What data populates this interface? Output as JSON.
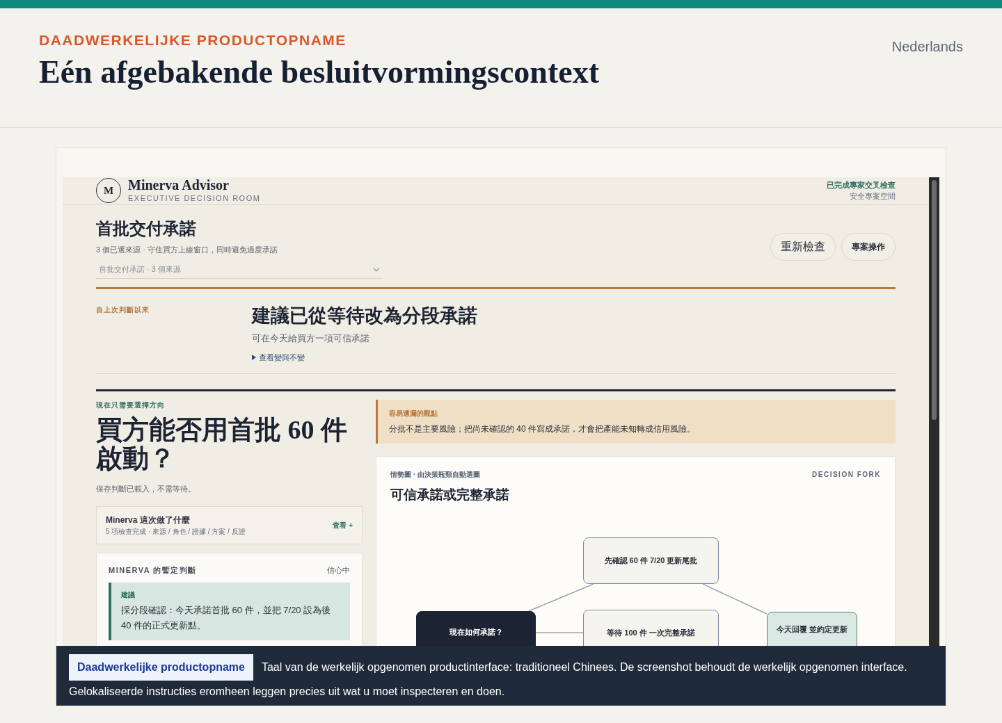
{
  "page": {
    "eyebrow": "DAADWERKELIJKE PRODUCTOPNAME",
    "title": "Eén afgebakende besluitvormingscontext",
    "language": "Nederlands"
  },
  "screenshot": {
    "app_header": {
      "logo_letter": "M",
      "brand": "Minerva Advisor",
      "subtitle": "EXECUTIVE DECISION ROOM",
      "status": "已完成專家交叉檢查",
      "workspace": "安全專案空間"
    },
    "project": {
      "title": "首批交付承諾",
      "subtitle": "3 個已選來源 · 守住買方上線窗口，同時避免過度承諾",
      "select_value": "首批交付承諾 · 3 個來源",
      "buttons": [
        "重新檢查",
        "專案操作"
      ]
    },
    "change": {
      "label": "自上次判斷以來",
      "heading": "建議已從等待改為分段承諾",
      "subheading": "可在今天給買方一項可信承諾",
      "toggle": "查看變與不變"
    },
    "question": {
      "eyebrow": "現在只需要選擇方向",
      "title": "買方能否用首批 60 件啟動？",
      "note": "保存判斷已載入，不需等待。"
    },
    "activity": {
      "title": "Minerva 這次做了什麼",
      "detail": "5 項檢查完成 · 來源 / 角色 / 證據 / 方案 / 反證",
      "action": "查看 +"
    },
    "verdict": {
      "label": "MINERVA 的暫定判斷",
      "confidence": "信心中",
      "recommendation_label": "建議",
      "recommendation": "採分段確認：今天承諾首批 60 件，並把 7/20 設為後 40 件的正式更新點。"
    },
    "insight": {
      "label": "容易遺漏的觀點",
      "text": "分批不是主要風險；把尚未確認的 40 件寫成承諾，才會把產能未知轉成信用風險。"
    },
    "diagram": {
      "eyebrow": "情勢圖 · 由決策瓶頸自動選圖",
      "tag": "DECISION FORK",
      "title": "可信承諾或完整承諾",
      "nodes": [
        {
          "label": "先確認 60 件 7/20 更新尾批",
          "kind": "option"
        },
        {
          "label": "現在如何承諾？",
          "kind": "start"
        },
        {
          "label": "等待 100 件 一次完整承諾",
          "kind": "option"
        },
        {
          "label": "今天回覆 並約定更新",
          "kind": "outcome"
        }
      ]
    }
  },
  "caption": {
    "badge": "Daadwerkelijke productopname",
    "text": "Taal van de werkelijk opgenomen productinterface: traditioneel Chinees. De screenshot behoudt de werkelijk opgenomen interface. Gelokaliseerde instructies eromheen leggen precies uit wat u moet inspecteren en doen."
  }
}
